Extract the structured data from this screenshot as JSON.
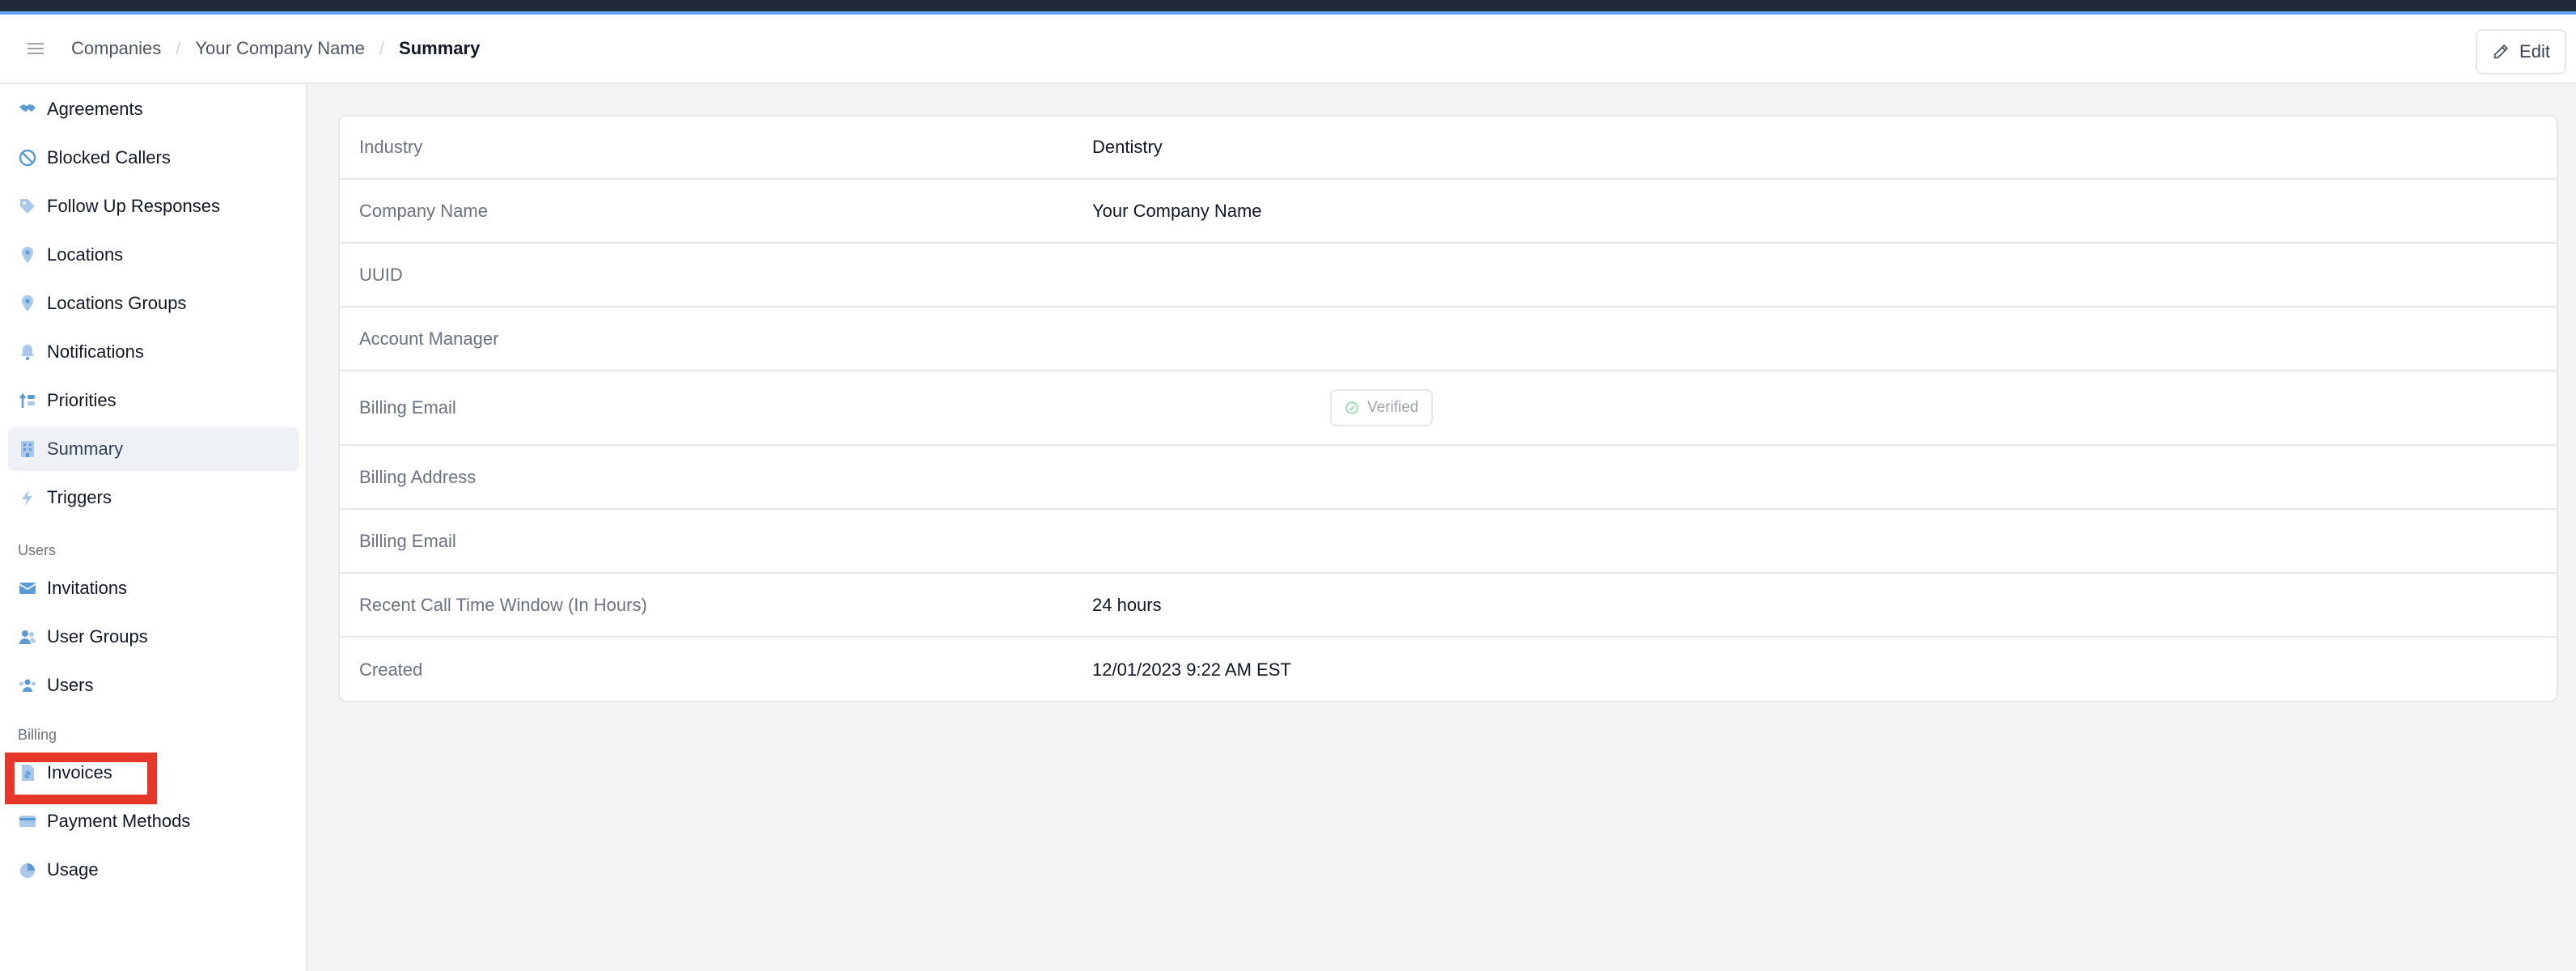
{
  "header": {
    "breadcrumb": [
      "Companies",
      "Your Company Name",
      "Summary"
    ],
    "edit_label": "Edit"
  },
  "sidebar": {
    "company_items": [
      {
        "label": "Agreements",
        "icon": "handshake-icon"
      },
      {
        "label": "Blocked Callers",
        "icon": "ban-icon"
      },
      {
        "label": "Follow Up Responses",
        "icon": "tag-icon"
      },
      {
        "label": "Locations",
        "icon": "map-pin-icon"
      },
      {
        "label": "Locations Groups",
        "icon": "map-pin-icon"
      },
      {
        "label": "Notifications",
        "icon": "bell-icon"
      },
      {
        "label": "Priorities",
        "icon": "priorities-icon"
      },
      {
        "label": "Summary",
        "icon": "building-icon",
        "active": true
      },
      {
        "label": "Triggers",
        "icon": "bolt-icon"
      }
    ],
    "users_section_label": "Users",
    "users_items": [
      {
        "label": "Invitations",
        "icon": "envelope-icon"
      },
      {
        "label": "User Groups",
        "icon": "user-group-icon"
      },
      {
        "label": "Users",
        "icon": "users-icon"
      }
    ],
    "billing_section_label": "Billing",
    "billing_items": [
      {
        "label": "Invoices",
        "icon": "document-icon"
      },
      {
        "label": "Payment Methods",
        "icon": "credit-card-icon"
      },
      {
        "label": "Usage",
        "icon": "pie-chart-icon"
      }
    ]
  },
  "summary": {
    "rows": [
      {
        "label": "Industry",
        "value": "Dentistry"
      },
      {
        "label": "Company Name",
        "value": "Your Company Name"
      },
      {
        "label": "UUID",
        "value": ""
      },
      {
        "label": "Account Manager",
        "value": ""
      },
      {
        "label": "Billing Email",
        "value": "",
        "badge": "Verified"
      },
      {
        "label": "Billing Address",
        "value": ""
      },
      {
        "label": "Billing Email",
        "value": ""
      },
      {
        "label": "Recent Call Time Window (In Hours)",
        "value": "24 hours"
      },
      {
        "label": "Created",
        "value": "12/01/2023 9:22 AM EST"
      }
    ]
  },
  "colors": {
    "accent": "#60a5fa",
    "icon": "#5b9bd5",
    "active_bg": "#eef2f7",
    "highlight": "#e5382a",
    "verified_green": "#86d6a0"
  }
}
